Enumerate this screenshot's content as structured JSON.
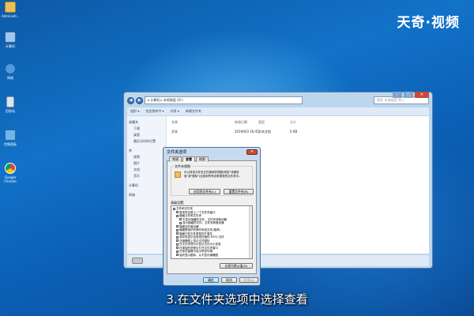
{
  "watermark": "天奇·视频",
  "caption": "3.在文件夹选项中选择查看",
  "desktop_icons": [
    {
      "label": "Administr...",
      "icon": "user-folder-icon"
    },
    {
      "label": "计算机",
      "icon": "computer-icon"
    },
    {
      "label": "网络",
      "icon": "network-icon"
    },
    {
      "label": "回收站",
      "icon": "recycle-bin-icon"
    },
    {
      "label": "控制面板",
      "icon": "control-panel-icon"
    },
    {
      "label": "Google Chrome",
      "icon": "chrome-icon"
    }
  ],
  "explorer": {
    "address": "▸ 计算机 ▸ 本地磁盘 (D:)",
    "search_placeholder": "搜索 本地磁盘 (D:)",
    "toolbar": [
      "组织 ▾",
      "包含到库中 ▾",
      "共享 ▾",
      "新建文件夹"
    ],
    "nav": {
      "favorites": "收藏夹",
      "favorites_items": [
        "下载",
        "桌面",
        "最近访问的位置"
      ],
      "libraries": "库",
      "libraries_items": [
        "视频",
        "图片",
        "文档",
        "音乐"
      ],
      "computer": "计算机",
      "network": "网络"
    },
    "columns": {
      "name": "名称",
      "date": "修改日期",
      "type": "类型",
      "size": "大小"
    },
    "rows": [
      {
        "name": "文本",
        "date": "2019/6/3 16:45",
        "type": "文本文档",
        "size": "0 KB"
      }
    ],
    "window_controls": [
      "–",
      "□",
      "✕"
    ]
  },
  "dialog": {
    "title": "文件夹选项",
    "tabs": [
      "常规",
      "查看",
      "搜索"
    ],
    "active_tab": "查看",
    "folder_views_label": "文件夹视图",
    "folder_views_text": "可以将该文件夹正在使用的视图(例如\"详细信息\"或\"图标\")应用到所有这种类型的文件夹中。",
    "apply_button": "应用到文件夹(L)",
    "reset_button": "重置文件夹(R)",
    "advanced_label": "高级设置:",
    "advanced_items": [
      "文件和文件夹",
      "登录时还原上一个文件夹窗口",
      "隐藏文件和文件夹",
      "不显示隐藏的文件、文件夹或驱动器",
      "显示隐藏的文件、文件夹和驱动器",
      "隐藏空的驱动器",
      "隐藏受保护的操作系统文件(推荐)",
      "隐藏已知文件类型的扩展名",
      "用彩色显示加密或压缩的 NTFS 文件",
      "在缩略图上显示文件图标",
      "在文件夹提示中显示文件大小信息",
      "在单独的进程中打开文件夹窗口",
      "在预览窗格中显示预览句柄",
      "始终显示图标，从不显示缩略图"
    ],
    "restore_button": "还原为默认值(D)",
    "ok_button": "确定",
    "cancel_button": "取消",
    "apply_bottom_button": "应用(A)",
    "close_glyph": "✕"
  }
}
